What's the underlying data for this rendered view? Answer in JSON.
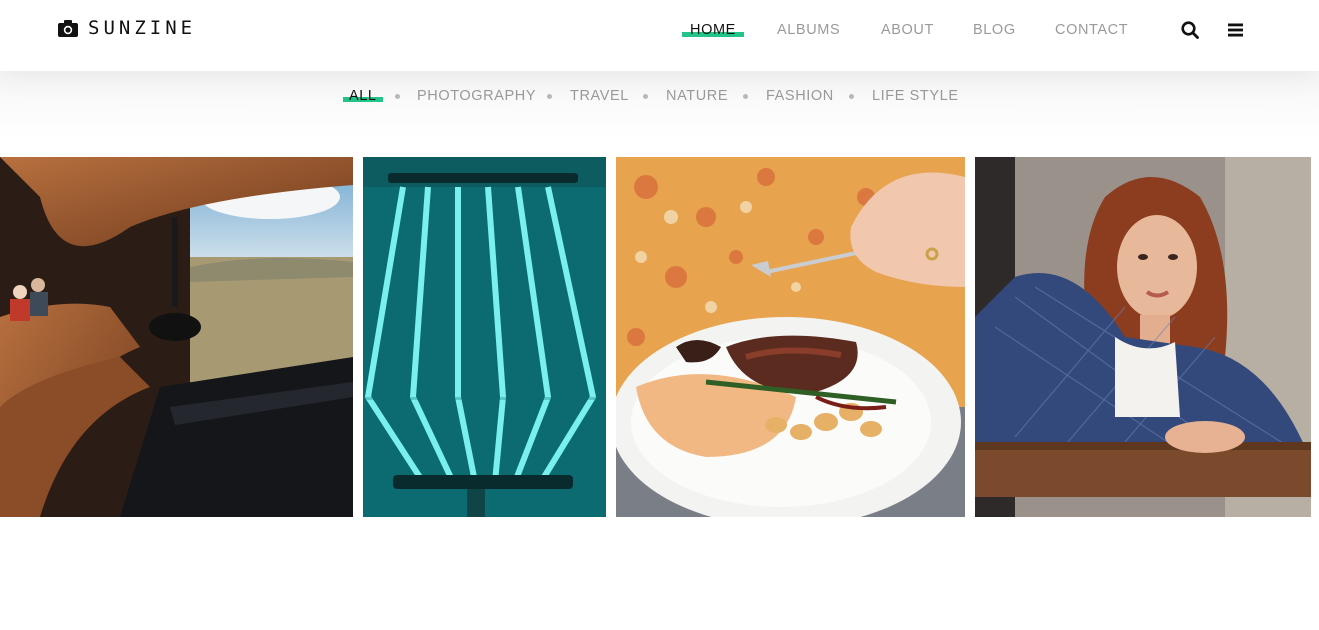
{
  "brand": {
    "name": "SUNZINE",
    "icon": "camera-icon"
  },
  "nav": {
    "items": [
      {
        "label": "HOME",
        "active": true
      },
      {
        "label": "ALBUMS",
        "active": false
      },
      {
        "label": "ABOUT",
        "active": false
      },
      {
        "label": "BLOG",
        "active": false
      },
      {
        "label": "CONTACT",
        "active": false
      }
    ],
    "search_icon": "search-icon",
    "menu_icon": "menu-icon"
  },
  "filters": {
    "items": [
      {
        "label": "ALL",
        "active": true
      },
      {
        "label": "PHOTOGRAPHY",
        "active": false
      },
      {
        "label": "TRAVEL",
        "active": false
      },
      {
        "label": "NATURE",
        "active": false
      },
      {
        "label": "FASHION",
        "active": false
      },
      {
        "label": "LIFE STYLE",
        "active": false
      }
    ]
  },
  "gallery": {
    "photos": [
      {
        "subject": "interior-viewpoint-with-mountain-window"
      },
      {
        "subject": "teal-neon-lamp"
      },
      {
        "subject": "plated-steak-dish"
      },
      {
        "subject": "portrait-woman-red-hair"
      }
    ]
  },
  "colors": {
    "accent": "#22c48a",
    "text_active": "#111111",
    "text_muted": "#9a9a9a"
  }
}
